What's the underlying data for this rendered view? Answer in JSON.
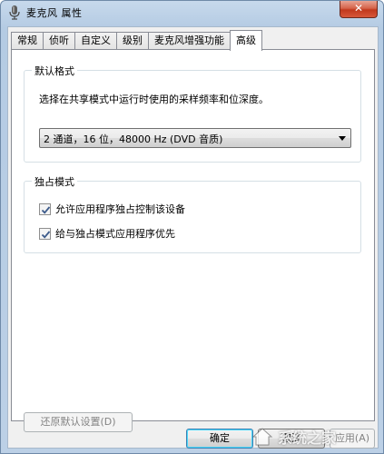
{
  "window": {
    "title": "麦克风 属性",
    "close_glyph": "✕"
  },
  "tabs": [
    {
      "label": "常规"
    },
    {
      "label": "侦听"
    },
    {
      "label": "自定义"
    },
    {
      "label": "级别"
    },
    {
      "label": "麦克风增强功能"
    },
    {
      "label": "高级",
      "active": true
    }
  ],
  "default_format": {
    "title": "默认格式",
    "description": "选择在共享模式中运行时使用的采样频率和位深度。",
    "selected": "2 通道，16 位，48000 Hz (DVD 音质)"
  },
  "exclusive_mode": {
    "title": "独占模式",
    "allow_control": {
      "label": "允许应用程序独占控制该设备",
      "checked": true
    },
    "give_priority": {
      "label": "给与独占模式应用程序优先",
      "checked": true
    }
  },
  "buttons": {
    "restore_defaults": "还原默认设置(D)",
    "ok": "确定",
    "cancel": "取消",
    "apply": "应用(A)"
  },
  "watermark": {
    "text": "系统之家"
  },
  "colors": {
    "titlebar": "#c7d9ec",
    "close_button": "#c1391d",
    "panel_bg": "#ffffff",
    "dialog_bg": "#f0f0f0"
  }
}
